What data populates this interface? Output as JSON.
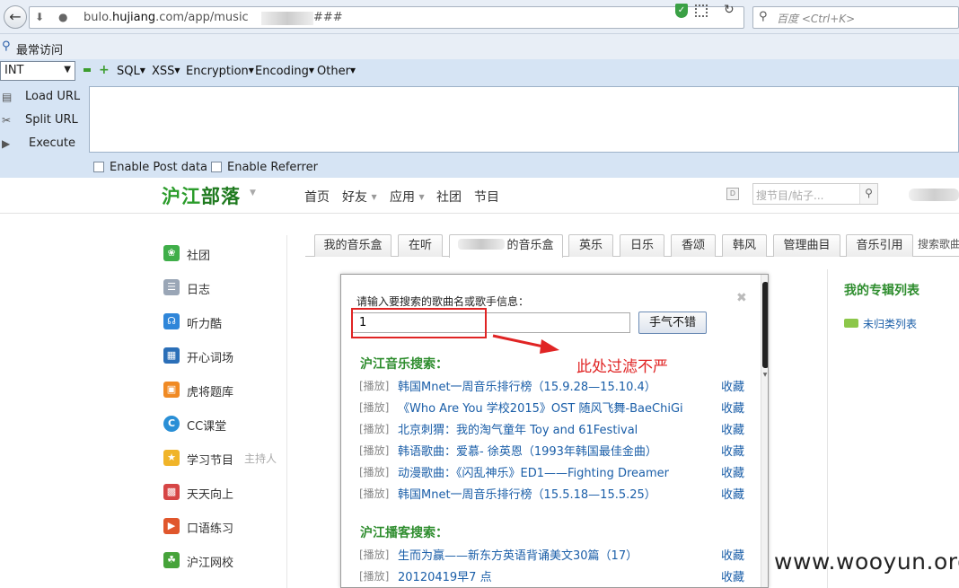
{
  "browser": {
    "url_domain": "bulo.",
    "url_host": "hujiang",
    "url_path": ".com/app/music",
    "url_hash": "###",
    "search_placeholder": "百度 <Ctrl+K>"
  },
  "bookmarks": {
    "label": "最常访问"
  },
  "hackbar": {
    "select_value": "INT",
    "menus": [
      "SQL",
      "XSS",
      "Encryption",
      "Encoding",
      "Other"
    ],
    "actions": [
      "Load URL",
      "Split URL",
      "Execute"
    ],
    "checkboxes": [
      "Enable Post data",
      "Enable Referrer"
    ]
  },
  "site": {
    "logo": [
      "沪江",
      "部落"
    ],
    "nav": [
      "首页",
      "好友",
      "应用",
      "社团",
      "节目"
    ],
    "search_placeholder": "搜节目/帖子..."
  },
  "sidebar": {
    "items": [
      {
        "label": "社团",
        "icon": "club-icon",
        "color": "#3fae49"
      },
      {
        "label": "日志",
        "icon": "diary-icon",
        "color": "#9aa6b6"
      },
      {
        "label": "听力酷",
        "icon": "headphone-icon",
        "color": "#2f86d9"
      },
      {
        "label": "开心词场",
        "icon": "words-icon",
        "color": "#2b6fb8"
      },
      {
        "label": "虎将题库",
        "icon": "quiz-icon",
        "color": "#f08a24"
      },
      {
        "label": "CC课堂",
        "icon": "cc-icon",
        "color": "#2a8fd6"
      },
      {
        "label": "学习节目",
        "icon": "program-icon",
        "color": "#f0b429",
        "extra": "主持人"
      },
      {
        "label": "天天向上",
        "icon": "calendar-icon",
        "color": "#d64545"
      },
      {
        "label": "口语练习",
        "icon": "speak-icon",
        "color": "#e0562c"
      },
      {
        "label": "沪江网校",
        "icon": "school-icon",
        "color": "#46a33a"
      }
    ]
  },
  "tabs": {
    "items": [
      "我的音乐盒",
      "在听",
      "的音乐盒",
      "英乐",
      "日乐",
      "香颂",
      "韩风",
      "管理曲目",
      "音乐引用"
    ],
    "more": "搜索歌曲"
  },
  "popup": {
    "prompt": "请输入要搜索的歌曲名或歌手信息：",
    "input_value": "1",
    "button": "手气不错",
    "section1": "沪江音乐搜索：",
    "section2": "沪江播客搜索：",
    "play_label": "[播放]",
    "fav_label": "收藏",
    "music_results": [
      "韩国Mnet一周音乐排行榜（15.9.28—15.10.4）",
      "《Who Are You 学校2015》OST 随风飞舞-BaeChiGi",
      "北京刺猬：我的淘气童年 Toy and 61Festival",
      "韩语歌曲：爱慕- 徐英恩（1993年韩国最佳金曲）",
      "动漫歌曲：《闪乱神乐》ED1——Fighting Dreamer",
      "韩国Mnet一周音乐排行榜（15.5.18—15.5.25）"
    ],
    "podcast_results": [
      "生而为赢——新东方英语背诵美文30篇（17）",
      "20120419早7 点"
    ]
  },
  "annotation": {
    "text": "此处过滤不严",
    "color": "#e02424"
  },
  "right_panel": {
    "title": "我的专辑列表",
    "item": "未归类列表"
  },
  "watermark": "www.wooyun.org"
}
